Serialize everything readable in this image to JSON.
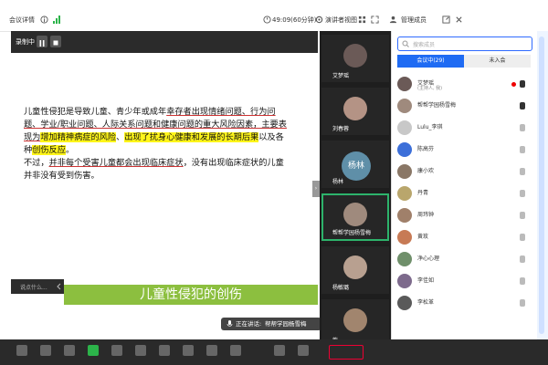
{
  "topbar": {
    "meeting_details": "会议详情",
    "timer": "49:09(60分钟)",
    "view_mode": "演讲者视图",
    "manage_members": "管理成员"
  },
  "main": {
    "recording_label": "录制中",
    "slide": {
      "para1_parts": [
        "儿童性侵犯是导致儿童、青少年或成年",
        "幸存者出现情绪问题、行为问题、学业/职业问题、人际关系问题和健康问题的重大风险因素，主要表现为",
        "增加精神病症的风险",
        "、",
        "出现了扰身心健康和发展的长期后果",
        "以及各种",
        "创伤反应",
        "。"
      ],
      "para2_parts": [
        "不过，",
        "并非每个受害儿童都会出现临床症状",
        "，没有出现临床症状的儿童并非没有受到伤害。"
      ]
    },
    "chat_tab_label": "说点什么...",
    "banner_title": "儿童性侵犯的创伤",
    "speaker": {
      "prefix": "正在讲话:",
      "name": "帮帮学园杨雪梅"
    }
  },
  "video_column": {
    "tiles": [
      {
        "name": "艾梦瑶"
      },
      {
        "name": "刘春蓉"
      },
      {
        "name": "杨林",
        "avatar_text": "杨林"
      },
      {
        "name": "帮帮学园杨雪梅"
      },
      {
        "name": "杨敏璐"
      },
      {
        "name": "熊..."
      }
    ]
  },
  "panel": {
    "search_placeholder": "搜索成员",
    "tab_in_meeting": "会议中(29)",
    "tab_not_joined": "未入会",
    "members": [
      {
        "name": "艾梦瑶",
        "sub": "(主持人, 我)",
        "mic": "on"
      },
      {
        "name": "帮帮学园杨雪梅",
        "sub": "",
        "mic": "on"
      },
      {
        "name": "Lulu_李琪",
        "sub": "",
        "mic": "off"
      },
      {
        "name": "陈高芬",
        "sub": "",
        "mic": "off"
      },
      {
        "name": "康小欢",
        "sub": "",
        "mic": "off"
      },
      {
        "name": "丹青",
        "sub": "",
        "mic": "off"
      },
      {
        "name": "周玮钟",
        "sub": "",
        "mic": "off"
      },
      {
        "name": "黄玫",
        "sub": "",
        "mic": "off"
      },
      {
        "name": "净心心理",
        "sub": "",
        "mic": "off"
      },
      {
        "name": "李佳如",
        "sub": "",
        "mic": "off"
      },
      {
        "name": "李松革",
        "sub": "",
        "mic": "off"
      }
    ]
  }
}
